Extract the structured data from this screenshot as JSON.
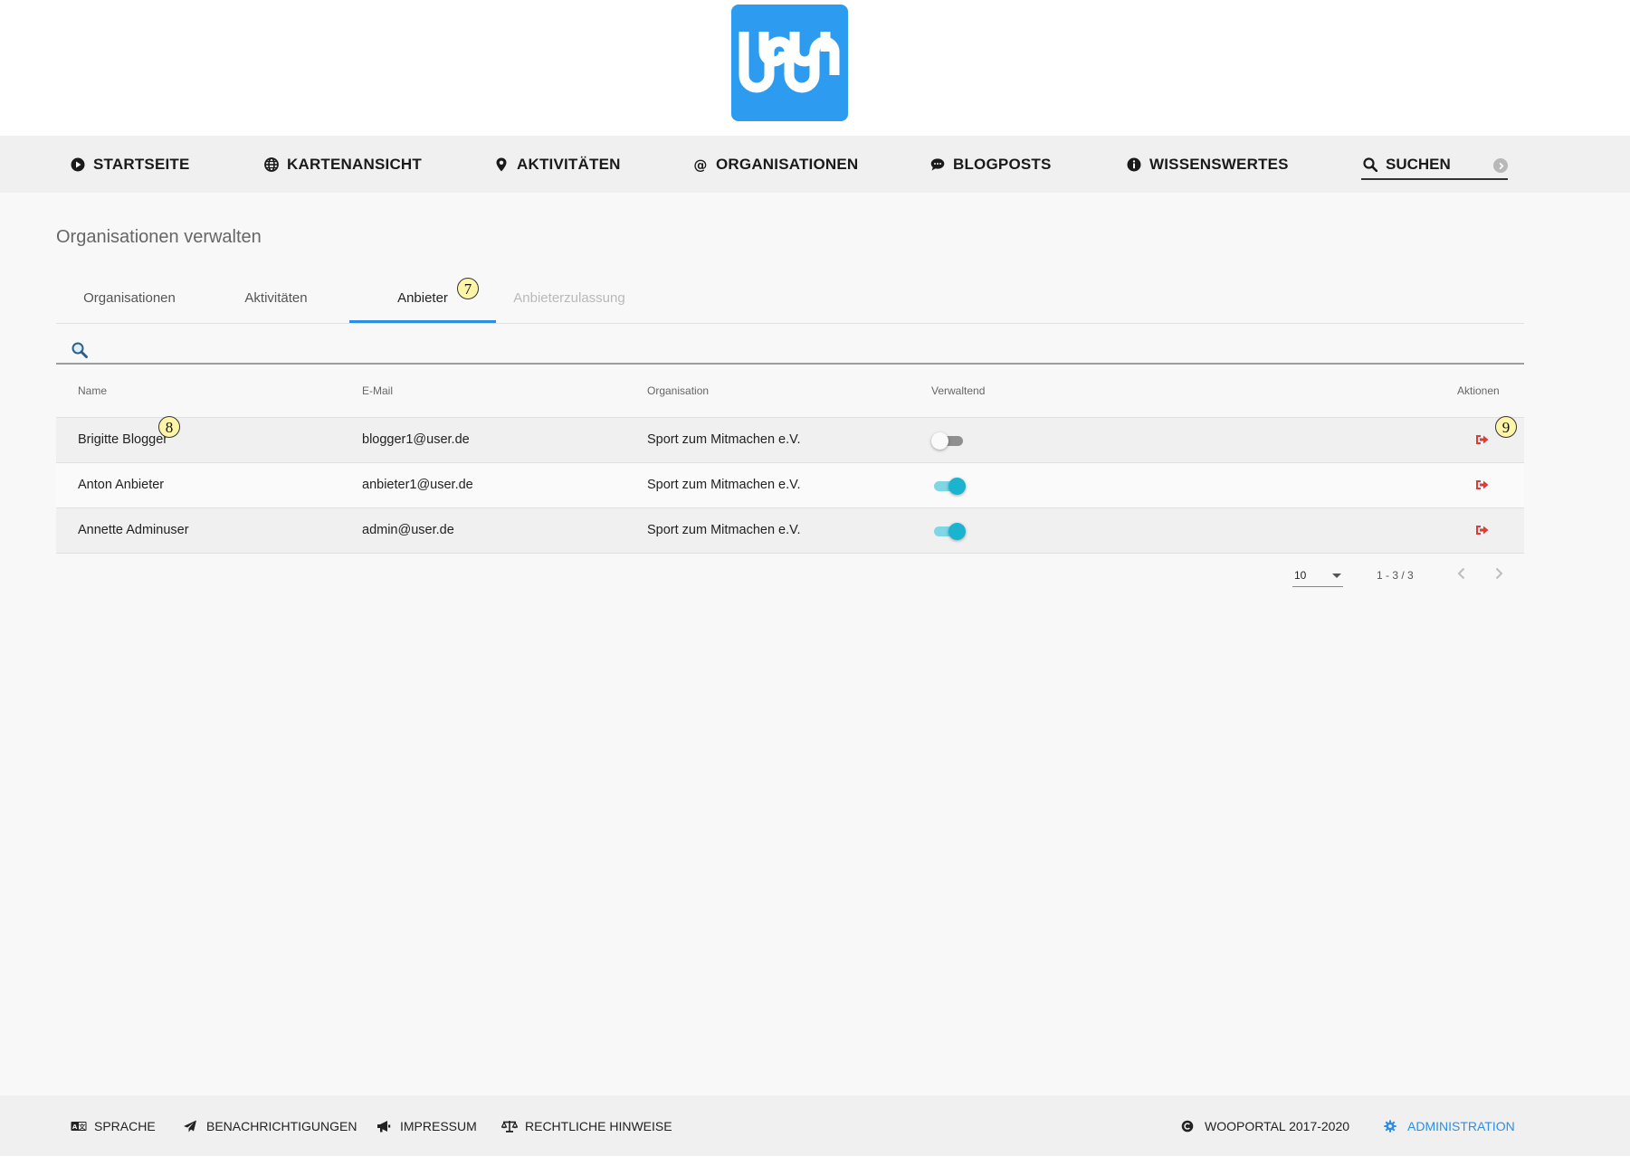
{
  "nav": {
    "items": [
      {
        "label": "STARTSEITE",
        "icon": "play-circle-icon"
      },
      {
        "label": "KARTENANSICHT",
        "icon": "globe-icon"
      },
      {
        "label": "AKTIVITÄTEN",
        "icon": "map-marker-icon"
      },
      {
        "label": "ORGANISATIONEN",
        "icon": "at-icon"
      },
      {
        "label": "BLOGPOSTS",
        "icon": "comment-icon"
      },
      {
        "label": "WISSENSWERTES",
        "icon": "info-circle-icon"
      }
    ],
    "search": {
      "placeholder": "SUCHEN",
      "icon": "search-icon"
    }
  },
  "page": {
    "title": "Organisationen verwalten"
  },
  "tabs": [
    {
      "label": "Organisationen",
      "state": "normal"
    },
    {
      "label": "Aktivitäten",
      "state": "normal"
    },
    {
      "label": "Anbieter",
      "state": "active"
    },
    {
      "label": "Anbieterzulassung",
      "state": "disabled"
    }
  ],
  "markers": {
    "m7": "7",
    "m8": "8",
    "m9": "9"
  },
  "table": {
    "columns": [
      "Name",
      "E-Mail",
      "Organisation",
      "Verwaltend",
      "Aktionen"
    ],
    "rows": [
      {
        "name": "Brigitte Blogger",
        "email": "blogger1@user.de",
        "organisation": "Sport zum Mitmachen e.V.",
        "verwaltend": false
      },
      {
        "name": "Anton Anbieter",
        "email": "anbieter1@user.de",
        "organisation": "Sport zum Mitmachen e.V.",
        "verwaltend": true
      },
      {
        "name": "Annette Adminuser",
        "email": "admin@user.de",
        "organisation": "Sport zum Mitmachen e.V.",
        "verwaltend": true
      }
    ]
  },
  "paginator": {
    "page_size": "10",
    "range": "1 - 3 / 3"
  },
  "footer": {
    "items": [
      {
        "label": "SPRACHE",
        "icon": "language-icon"
      },
      {
        "label": "BENACHRICHTIGUNGEN",
        "icon": "paper-plane-icon"
      },
      {
        "label": "IMPRESSUM",
        "icon": "bullhorn-icon"
      },
      {
        "label": "RECHTLICHE HINWEISE",
        "icon": "balance-scale-icon"
      }
    ],
    "copyright": "WOOPORTAL 2017-2020",
    "admin": "ADMINISTRATION"
  },
  "colors": {
    "brand": "#2d9bf0",
    "accent": "#2d8ee6",
    "toggle_on": "#1ab3d0",
    "action_red": "#e53935"
  }
}
